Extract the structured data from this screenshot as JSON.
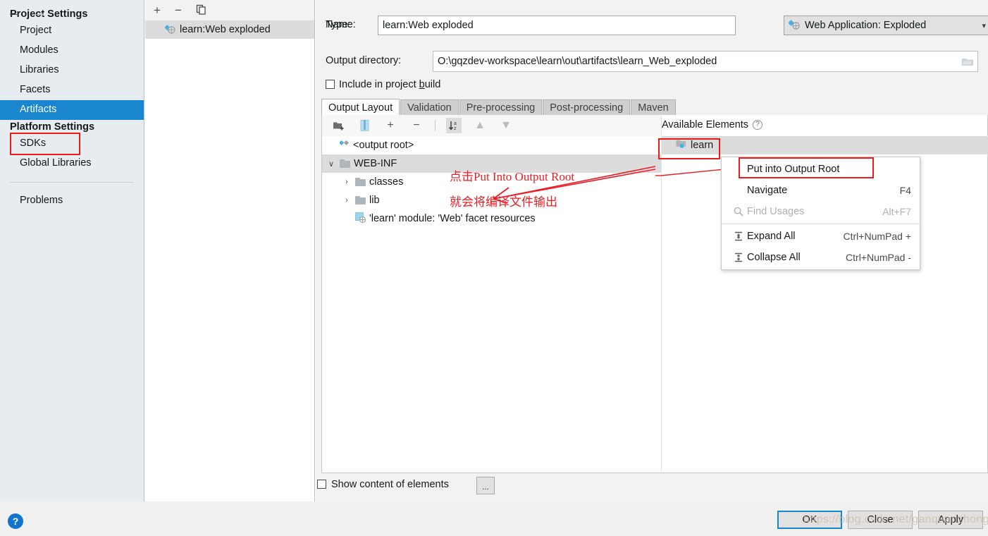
{
  "sidebar": {
    "nav": {
      "back": "←",
      "forward": "→"
    },
    "groups": [
      {
        "title": "Project Settings",
        "items": [
          "Project",
          "Modules",
          "Libraries",
          "Facets",
          "Artifacts"
        ],
        "selected": "Artifacts"
      },
      {
        "title": "Platform Settings",
        "items": [
          "SDKs",
          "Global Libraries"
        ]
      }
    ],
    "problems": "Problems",
    "help_label": "?"
  },
  "artifact_list": {
    "toolbar": {
      "add": "+",
      "remove": "−",
      "copy": "copy-icon"
    },
    "items": [
      {
        "label": "learn:Web exploded",
        "selected": true
      }
    ]
  },
  "form": {
    "name_label": "Name:",
    "name_value": "learn:Web exploded",
    "type_label": "Type:",
    "type_value": "Web Application: Exploded",
    "output_dir_label": "Output directory:",
    "output_dir_value": "O:\\gqzdev-workspace\\learn\\out\\artifacts\\learn_Web_exploded",
    "include_build_pre": "Include in project ",
    "include_build_mnemonic": "b",
    "include_build_post": "uild",
    "include_build_checked": false
  },
  "tabs": [
    {
      "label": "Output Layout",
      "active": true
    },
    {
      "label": "Validation",
      "active": false
    },
    {
      "label": "Pre-processing",
      "active": false
    },
    {
      "label": "Post-processing",
      "active": false
    },
    {
      "label": "Maven",
      "active": false
    }
  ],
  "layout_toolbar": {
    "create_directory": "new-folder-icon",
    "create_archive": "archive-icon",
    "add": "+",
    "remove": "−",
    "sort": "sort-az-icon",
    "move_up": "▲",
    "move_down": "▼"
  },
  "tree": [
    {
      "label": "<output root>",
      "icon": "artifact-icon",
      "indent": 0,
      "twist": "",
      "selected": false
    },
    {
      "label": "WEB-INF",
      "icon": "folder",
      "indent": 1,
      "twist": "∨",
      "selected": true
    },
    {
      "label": "classes",
      "icon": "folder",
      "indent": 2,
      "twist": "›",
      "selected": false
    },
    {
      "label": "lib",
      "icon": "folder",
      "indent": 2,
      "twist": "›",
      "selected": false
    },
    {
      "label": "'learn' module: 'Web' facet resources",
      "icon": "facet-icon",
      "indent": 2,
      "twist": "",
      "selected": false
    }
  ],
  "available": {
    "header": "Available Elements",
    "help": "?",
    "items": [
      {
        "label": "learn",
        "selected": true
      }
    ]
  },
  "context_menu": [
    {
      "label": "Put into Output Root",
      "shortcut": "",
      "icon": "",
      "disabled": false,
      "highlighted": true
    },
    {
      "label": "Navigate",
      "shortcut": "F4",
      "icon": "",
      "disabled": false,
      "highlighted": false
    },
    {
      "label": "Find Usages",
      "shortcut": "Alt+F7",
      "icon": "search-icon",
      "disabled": true,
      "highlighted": false
    },
    {
      "label": "Expand All",
      "shortcut": "Ctrl+NumPad +",
      "icon": "expand-all-icon",
      "disabled": false,
      "highlighted": false
    },
    {
      "label": "Collapse All",
      "shortcut": "Ctrl+NumPad -",
      "icon": "collapse-all-icon",
      "disabled": false,
      "highlighted": false
    }
  ],
  "bottom": {
    "show_content_label": "Show content of elements",
    "show_content_checked": false,
    "dots_button": "..."
  },
  "footer": {
    "ok": "OK",
    "close": "Close",
    "apply": "Apply",
    "watermark": "https://blog.csdn.net/ganquanzhong"
  },
  "annotations": {
    "line1": "点击Put Into Output Root",
    "line2": "就会将编译文件输出"
  },
  "colors": {
    "accent": "#1a86cf",
    "annotation_red": "#ec1c24",
    "highlight_box": "#ee1b1b",
    "sidebar_bg": "#e6ecef"
  }
}
